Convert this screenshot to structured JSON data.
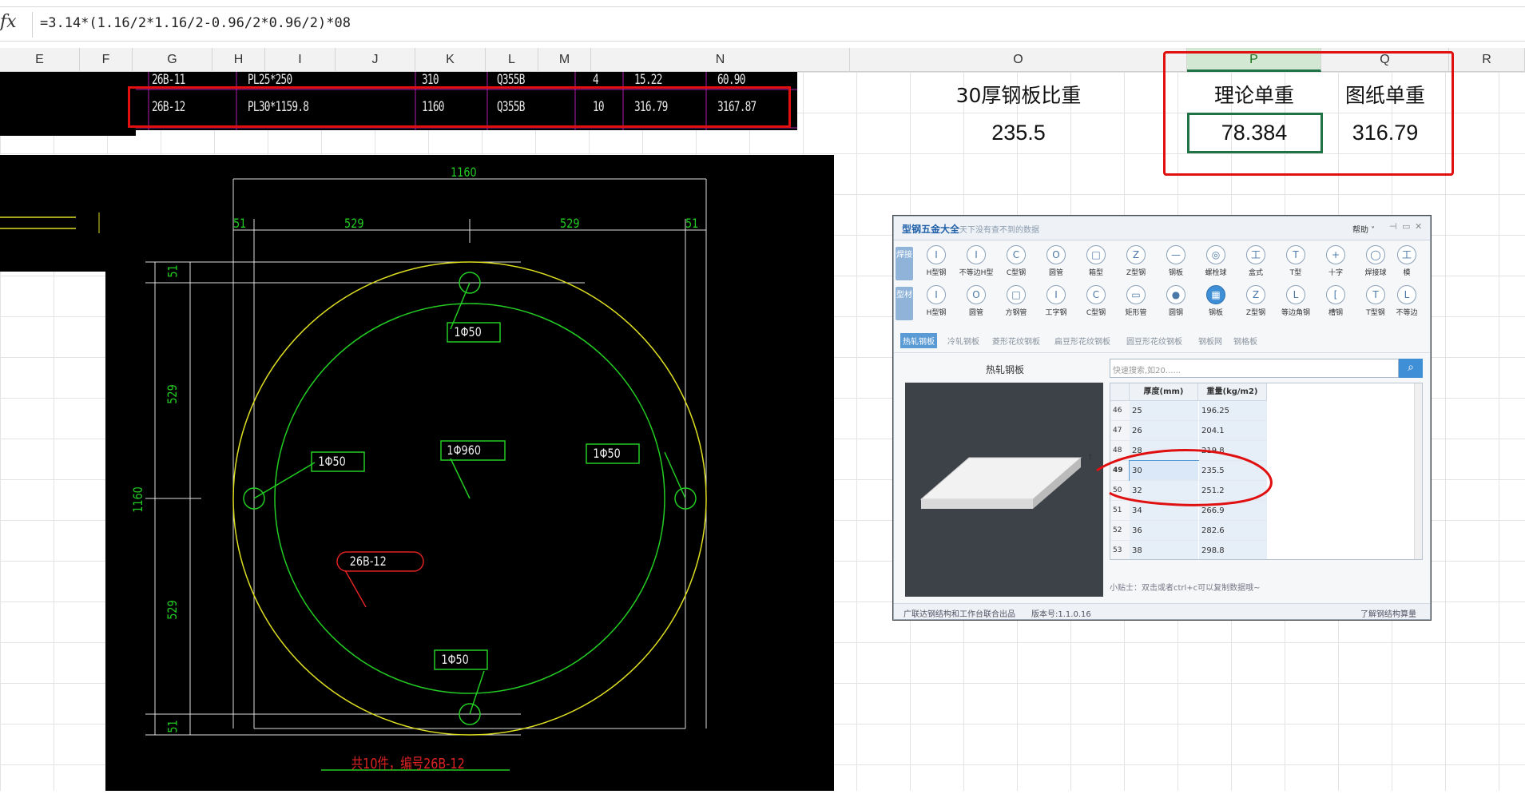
{
  "formula_bar": {
    "fx_label": "fx",
    "formula": "=3.14*(1.16/2*1.16/2-0.96/2*0.96/2)*08"
  },
  "columns": [
    "E",
    "F",
    "G",
    "H",
    "I",
    "J",
    "K",
    "L",
    "M",
    "N",
    "O",
    "P",
    "Q",
    "R"
  ],
  "cad_rows": [
    [
      "26B-11",
      "PL25*250",
      "310",
      "Q355B",
      "4",
      "15.22",
      "60.90"
    ],
    [
      "26B-12",
      "PL30*1159.8",
      "1160",
      "Q355B",
      "10",
      "316.79",
      "3167.87"
    ]
  ],
  "cad_drawing": {
    "dim_top": "1160",
    "dim_51_left": "51",
    "dim_529_a": "529",
    "dim_529_b": "529",
    "dim_51_right": "51",
    "dim_left_51_top": "51",
    "dim_left_529_top": "529",
    "dim_left_1160": "1160",
    "dim_left_529_bottom": "529",
    "dim_left_51_bottom": "51",
    "label_hole_top": "1Φ50",
    "label_hole_left": "1Φ50",
    "label_hole_right": "1Φ50",
    "label_hole_bottom": "1Φ50",
    "label_center": "1Φ960",
    "part_tag": "26B-12",
    "caption": "共10件，编号26B-12",
    "line_color": "#22cc22",
    "outer_color": "#dddd22",
    "tag_color": "#dd2222"
  },
  "sheet": {
    "o_header": "30厚钢板比重",
    "o_value": "235.5",
    "p_header": "理论单重",
    "p_value": "78.384",
    "q_header": "图纸单重",
    "q_value": "316.79"
  },
  "tool": {
    "title": "型钢五金大全",
    "subtitle": "天下没有查不到的数据",
    "help": "帮助 ˅",
    "row1_side": "焊接",
    "row1": [
      {
        "icon": "H-beam-icon",
        "glyph": "I",
        "label": "H型钢"
      },
      {
        "icon": "unequal-h-beam-icon",
        "glyph": "I",
        "label": "不等边H型"
      },
      {
        "icon": "c-steel-icon",
        "glyph": "C",
        "label": "C型钢"
      },
      {
        "icon": "round-pipe-icon",
        "glyph": "O",
        "label": "圆管"
      },
      {
        "icon": "box-icon",
        "glyph": "□",
        "label": "箱型"
      },
      {
        "icon": "z-steel-icon",
        "glyph": "Z",
        "label": "Z型钢"
      },
      {
        "icon": "plate-icon",
        "glyph": "—",
        "label": "钢板"
      },
      {
        "icon": "bolt-ball-icon",
        "glyph": "◎",
        "label": "螺栓球"
      },
      {
        "icon": "box-shape-icon",
        "glyph": "工",
        "label": "盒式"
      },
      {
        "icon": "t-steel-icon",
        "glyph": "T",
        "label": "T型"
      },
      {
        "icon": "cross-icon",
        "glyph": "+",
        "label": "十字"
      },
      {
        "icon": "welded-ball-icon",
        "glyph": "◯",
        "label": "焊接球"
      },
      {
        "icon": "more-icon",
        "glyph": "工",
        "label": "模"
      }
    ],
    "row2_side": "型材",
    "row2": [
      {
        "icon": "H-beam-icon",
        "glyph": "I",
        "label": "H型钢"
      },
      {
        "icon": "round-pipe-icon",
        "glyph": "O",
        "label": "圆管"
      },
      {
        "icon": "square-pipe-icon",
        "glyph": "□",
        "label": "方钢管"
      },
      {
        "icon": "i-beam-icon",
        "glyph": "I",
        "label": "工字钢"
      },
      {
        "icon": "c-steel-icon",
        "glyph": "C",
        "label": "C型钢"
      },
      {
        "icon": "rect-pipe-icon",
        "glyph": "▭",
        "label": "矩形管"
      },
      {
        "icon": "round-bar-icon",
        "glyph": "●",
        "label": "圆钢"
      },
      {
        "icon": "steel-plate-icon",
        "glyph": "▦",
        "label": "钢板"
      },
      {
        "icon": "z-steel-icon",
        "glyph": "Z",
        "label": "Z型钢"
      },
      {
        "icon": "equal-angle-icon",
        "glyph": "L",
        "label": "等边角钢"
      },
      {
        "icon": "channel-icon",
        "glyph": "[",
        "label": "槽钢"
      },
      {
        "icon": "t-steel-icon",
        "glyph": "T",
        "label": "T型钢"
      },
      {
        "icon": "unequal-angle-icon",
        "glyph": "L",
        "label": "不等边"
      }
    ],
    "tabs": [
      "热轧钢板",
      "冷轧钢板",
      "菱形花纹钢板",
      "扁豆形花纹钢板",
      "圆豆形花纹钢板",
      "钢板网",
      "钢格板"
    ],
    "panel_title": "热轧钢板",
    "search_placeholder": "快速搜索,如20......",
    "col_thick": "厚度(mm)",
    "col_weight": "重量(kg/m2)",
    "rows": [
      {
        "idx": "46",
        "thick": "25",
        "weight": "196.25"
      },
      {
        "idx": "47",
        "thick": "26",
        "weight": "204.1"
      },
      {
        "idx": "48",
        "thick": "28",
        "weight": "219.8"
      },
      {
        "idx": "49",
        "thick": "30",
        "weight": "235.5"
      },
      {
        "idx": "50",
        "thick": "32",
        "weight": "251.2"
      },
      {
        "idx": "51",
        "thick": "34",
        "weight": "266.9"
      },
      {
        "idx": "52",
        "thick": "36",
        "weight": "282.6"
      },
      {
        "idx": "53",
        "thick": "38",
        "weight": "298.8"
      }
    ],
    "tip": "小贴士：双击或者ctrl+c可以复制数据哦~",
    "footer_left": "广联达钢结构和工作台联合出品",
    "footer_version": "版本号:1.1.0.16",
    "footer_right": "了解钢结构算量",
    "preview_t": "t"
  }
}
